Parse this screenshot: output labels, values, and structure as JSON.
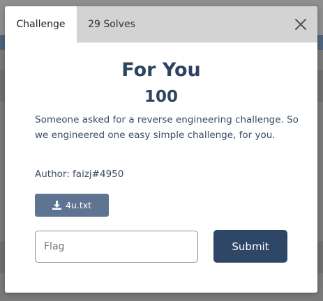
{
  "modal": {
    "tabs": [
      {
        "label": "Challenge",
        "active": true
      },
      {
        "label": "29 Solves",
        "active": false
      }
    ],
    "close_icon": "close-icon",
    "challenge": {
      "name": "For You",
      "points": "100",
      "description": "Someone asked for a reverse engineering challenge. So we engineered one easy simple challenge, for you.",
      "author": "Author: faizj#4950",
      "file": {
        "label": "4u.txt",
        "icon": "download-icon"
      }
    },
    "flag_input": {
      "placeholder": "Flag",
      "value": ""
    },
    "submit_label": "Submit"
  },
  "colors": {
    "heading": "#2d4361",
    "file_button": "#5f7493",
    "submit_button": "#2f4766",
    "tab_strip": "#d3d3d3",
    "backdrop": "#7a7a7a"
  }
}
